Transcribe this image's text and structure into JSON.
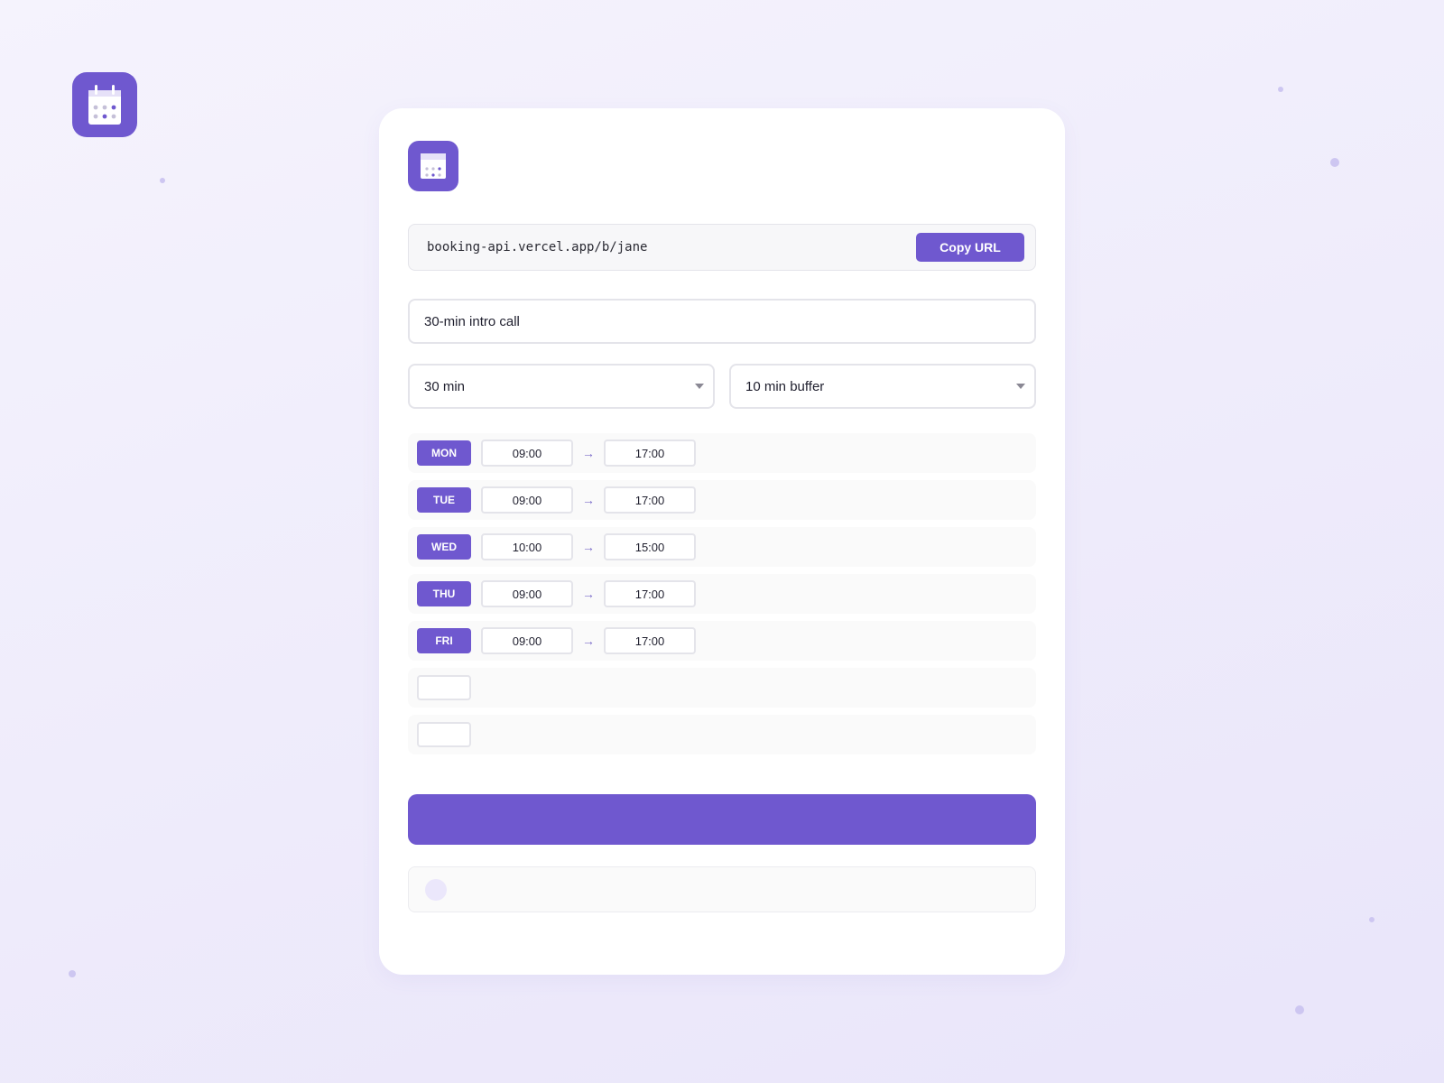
{
  "logo": {
    "icon": "calendar-icon",
    "accent": "#6f58cf"
  },
  "card": {
    "logo_icon": "calendar-icon",
    "url": {
      "value": "booking-api.vercel.app/b/jane",
      "copy_label": "Copy URL"
    },
    "event_title": {
      "value": "30-min intro call"
    },
    "duration": {
      "selected": "30 min"
    },
    "buffer": {
      "selected": "10 min buffer"
    },
    "schedule": [
      {
        "day": "MON",
        "start": "09:00",
        "end": "17:00"
      },
      {
        "day": "TUE",
        "start": "09:00",
        "end": "17:00"
      },
      {
        "day": "WED",
        "start": "10:00",
        "end": "15:00"
      },
      {
        "day": "THU",
        "start": "09:00",
        "end": "17:00"
      },
      {
        "day": "FRI",
        "start": "09:00",
        "end": "17:00"
      }
    ],
    "arrow": "→"
  },
  "colors": {
    "accent": "#6f58cf",
    "status_dot": "#ebe7fb"
  }
}
